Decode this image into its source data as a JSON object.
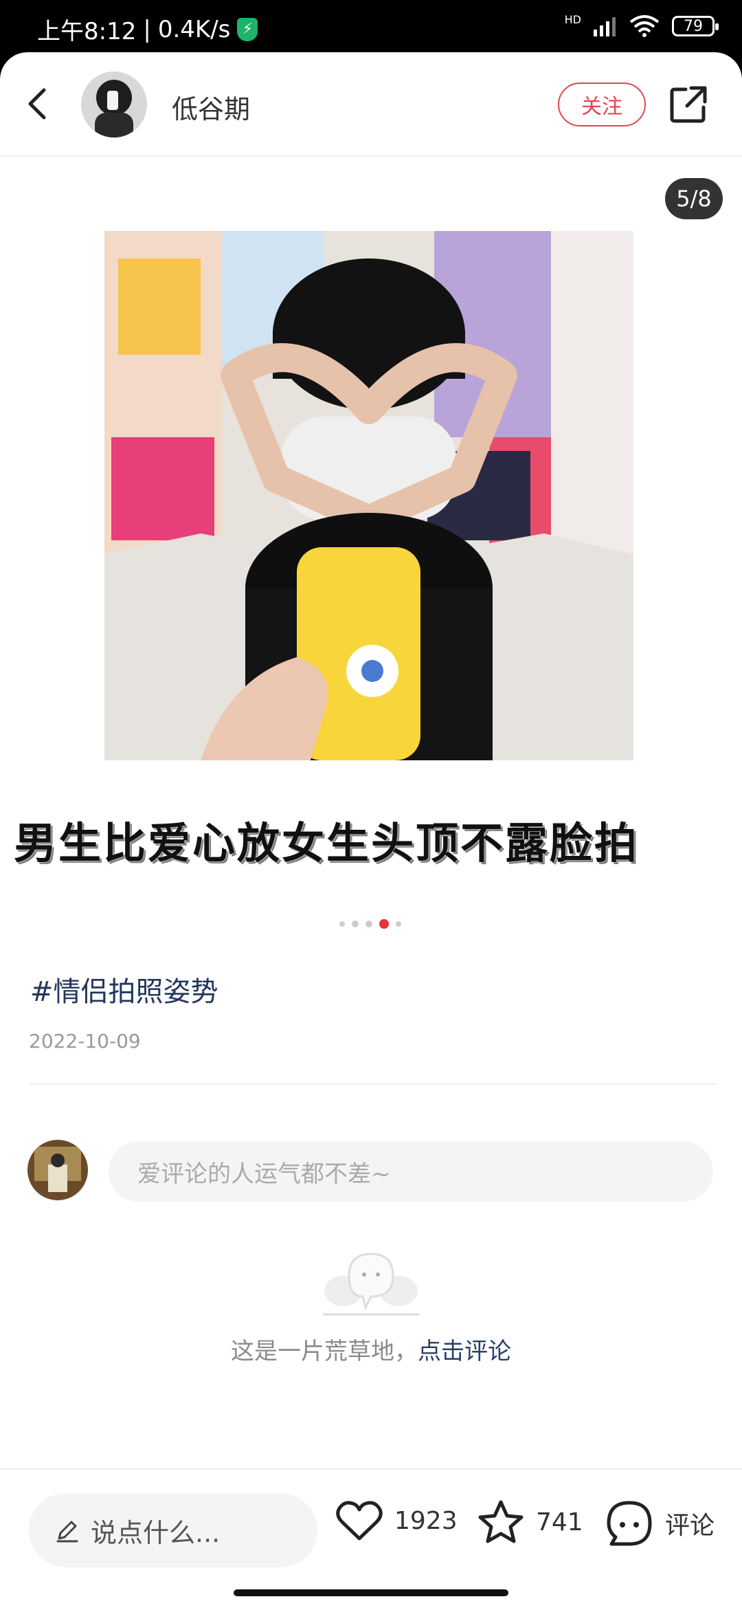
{
  "status_bar": {
    "time": "上午8:12",
    "speed": "0.4K/s",
    "network": "HD",
    "battery": "79"
  },
  "header": {
    "username": "低谷期",
    "follow_label": "关注"
  },
  "post": {
    "image_counter": "5/8",
    "caption_text": "男生比爱心放女生头顶不露脸拍",
    "hashtag": "#情侣拍照姿势",
    "date": "2022-10-09",
    "pager": {
      "total": 5,
      "active_index": 3
    }
  },
  "comments": {
    "input_placeholder": "爱评论的人运气都不差~",
    "empty_text": "这是一片荒草地，",
    "empty_link": "点击评论"
  },
  "bottom_bar": {
    "say_placeholder": "说点什么...",
    "like_count": "1923",
    "collect_count": "741",
    "comment_label": "评论"
  },
  "colors": {
    "accent": "#e8323c",
    "link": "#2a3f66"
  }
}
